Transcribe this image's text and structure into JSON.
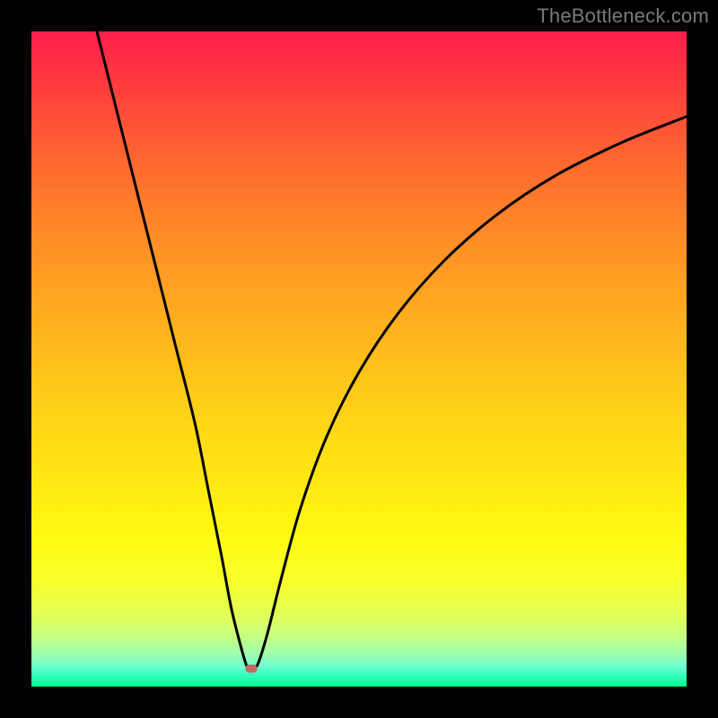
{
  "watermark": "TheBottleneck.com",
  "marker": {
    "x_frac": 0.335,
    "y_frac": 0.972,
    "color": "#c26a5f"
  },
  "chart_data": {
    "type": "line",
    "title": "",
    "xlabel": "",
    "ylabel": "",
    "xlim": [
      0,
      100
    ],
    "ylim": [
      0,
      100
    ],
    "grid": false,
    "legend": false,
    "series": [
      {
        "name": "bottleneck-curve",
        "x": [
          10,
          13,
          16,
          19,
          22,
          25,
          27,
          29,
          30.5,
          32,
          33,
          33.5,
          34.5,
          36,
          38,
          41,
          45,
          50,
          56,
          63,
          71,
          80,
          90,
          100
        ],
        "y": [
          100,
          88,
          76,
          64,
          52,
          40,
          30,
          20,
          12,
          6,
          2.8,
          2.8,
          3.3,
          8,
          16,
          27,
          38,
          48,
          57,
          65,
          72,
          78,
          83,
          87
        ]
      }
    ],
    "gradient_stops": [
      {
        "pos": 0.0,
        "color": "#ff1e4c"
      },
      {
        "pos": 0.5,
        "color": "#ffbe1b"
      },
      {
        "pos": 0.8,
        "color": "#fffb12"
      },
      {
        "pos": 1.0,
        "color": "#00ff8c"
      }
    ],
    "annotations": [
      {
        "type": "marker",
        "x": 33.5,
        "y": 2.8,
        "color": "#c26a5f"
      }
    ]
  }
}
